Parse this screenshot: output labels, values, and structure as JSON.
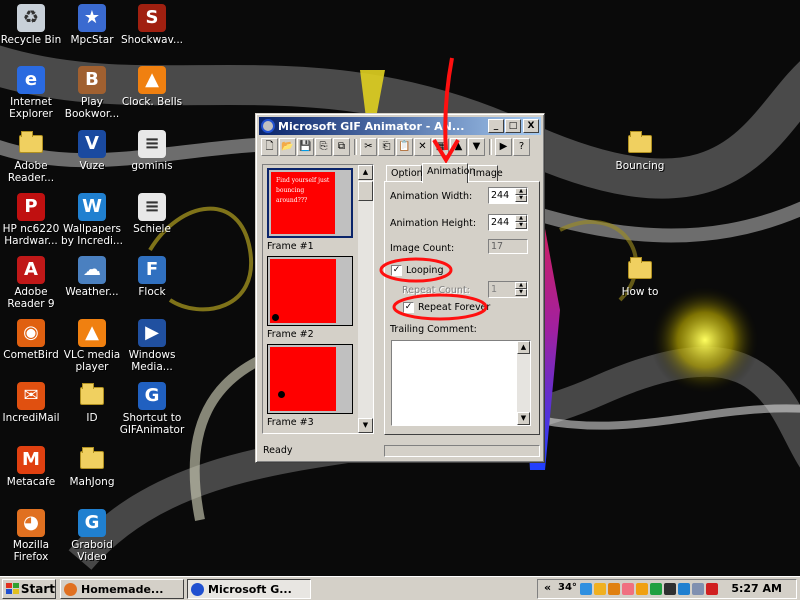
{
  "desktop": {
    "icons": [
      {
        "label": "Recycle Bin",
        "icon": "recycle-bin-icon"
      },
      {
        "label": "MpcStar",
        "icon": "mpcstar-icon"
      },
      {
        "label": "Shockwav...",
        "icon": "shockwave-icon"
      },
      {
        "label": "Internet Explorer",
        "icon": "internet-explorer-icon"
      },
      {
        "label": "Play Bookwor...",
        "icon": "bookworm-icon"
      },
      {
        "label": "Clock. Bells",
        "icon": "vlc-cone-icon"
      },
      {
        "label": "Adobe Reader...",
        "icon": "folder-icon"
      },
      {
        "label": "Vuze",
        "icon": "vuze-icon"
      },
      {
        "label": "gominis",
        "icon": "document-icon"
      },
      {
        "label": "HP nc6220 Hardwar...",
        "icon": "pdf-icon"
      },
      {
        "label": "Wallpapers by Incredi...",
        "icon": "wallpapers-icon"
      },
      {
        "label": "Schiele",
        "icon": "document-icon"
      },
      {
        "label": "Adobe Reader 9",
        "icon": "adobe-reader-icon"
      },
      {
        "label": "Weather...",
        "icon": "weather-icon"
      },
      {
        "label": "Flock",
        "icon": "flock-icon"
      },
      {
        "label": "CometBird",
        "icon": "cometbird-icon"
      },
      {
        "label": "VLC media player",
        "icon": "vlc-cone-icon"
      },
      {
        "label": "Windows Media...",
        "icon": "windows-media-icon"
      },
      {
        "label": "IncrediMail",
        "icon": "incredimail-icon"
      },
      {
        "label": "ID",
        "icon": "folder-icon"
      },
      {
        "label": "Shortcut to GIFAnimator",
        "icon": "gif-animator-icon"
      },
      {
        "label": "Metacafe",
        "icon": "metacafe-icon"
      },
      {
        "label": "MahJong",
        "icon": "folder-icon"
      },
      {
        "label": "Mozilla Firefox",
        "icon": "firefox-icon"
      },
      {
        "label": "Graboid Video",
        "icon": "graboid-icon"
      },
      {
        "label": "Bouncing",
        "icon": "folder-icon"
      },
      {
        "label": "How to",
        "icon": "folder-icon"
      }
    ]
  },
  "window": {
    "title": "Microsoft GIF Animator - AN...",
    "caption_buttons": {
      "minimize": "_",
      "maximize": "□",
      "close": "X"
    },
    "toolbar": [
      {
        "name": "new-icon",
        "glyph": "🗋"
      },
      {
        "name": "open-icon",
        "glyph": "📂"
      },
      {
        "name": "save-icon",
        "glyph": "💾"
      },
      {
        "name": "insert-icon",
        "glyph": "⎘"
      },
      {
        "name": "save-as-icon",
        "glyph": "⧉"
      },
      {
        "name": "sep"
      },
      {
        "name": "cut-icon",
        "glyph": "✂"
      },
      {
        "name": "copy-icon",
        "glyph": "⎗"
      },
      {
        "name": "paste-icon",
        "glyph": "📋"
      },
      {
        "name": "delete-icon",
        "glyph": "✕"
      },
      {
        "name": "select-all-icon",
        "glyph": "▦"
      },
      {
        "name": "move-up-icon",
        "glyph": "▲"
      },
      {
        "name": "move-down-icon",
        "glyph": "▼"
      },
      {
        "name": "sep"
      },
      {
        "name": "play-icon",
        "glyph": "▶"
      },
      {
        "name": "help-icon",
        "glyph": "?"
      }
    ],
    "frames": [
      {
        "label": "Frame #1",
        "text": "Find yourself just bouncing around???"
      },
      {
        "label": "Frame #2"
      },
      {
        "label": "Frame #3"
      }
    ],
    "tabs": [
      {
        "label": "Options"
      },
      {
        "label": "Animation"
      },
      {
        "label": "Image"
      }
    ],
    "animation": {
      "width_label": "Animation Width:",
      "width_value": "244",
      "height_label": "Animation Height:",
      "height_value": "244",
      "image_count_label": "Image Count:",
      "image_count_value": "17",
      "looping_label": "Looping",
      "looping_checked": true,
      "repeat_count_label": "Repeat Count:",
      "repeat_count_value": "1",
      "repeat_forever_label": "Repeat Forever",
      "repeat_forever_checked": true,
      "trailing_comment_label": "Trailing Comment:"
    },
    "status": "Ready"
  },
  "annotation_color": "#ff1010",
  "taskbar": {
    "start_label": "Start",
    "tasks": [
      {
        "label": "Homemade...",
        "icon": "firefox-icon"
      },
      {
        "label": "Microsoft G...",
        "icon": "gif-animator-icon"
      }
    ],
    "tray": {
      "collapse": "«",
      "temp": "34°",
      "clock": "5:27 AM"
    }
  }
}
